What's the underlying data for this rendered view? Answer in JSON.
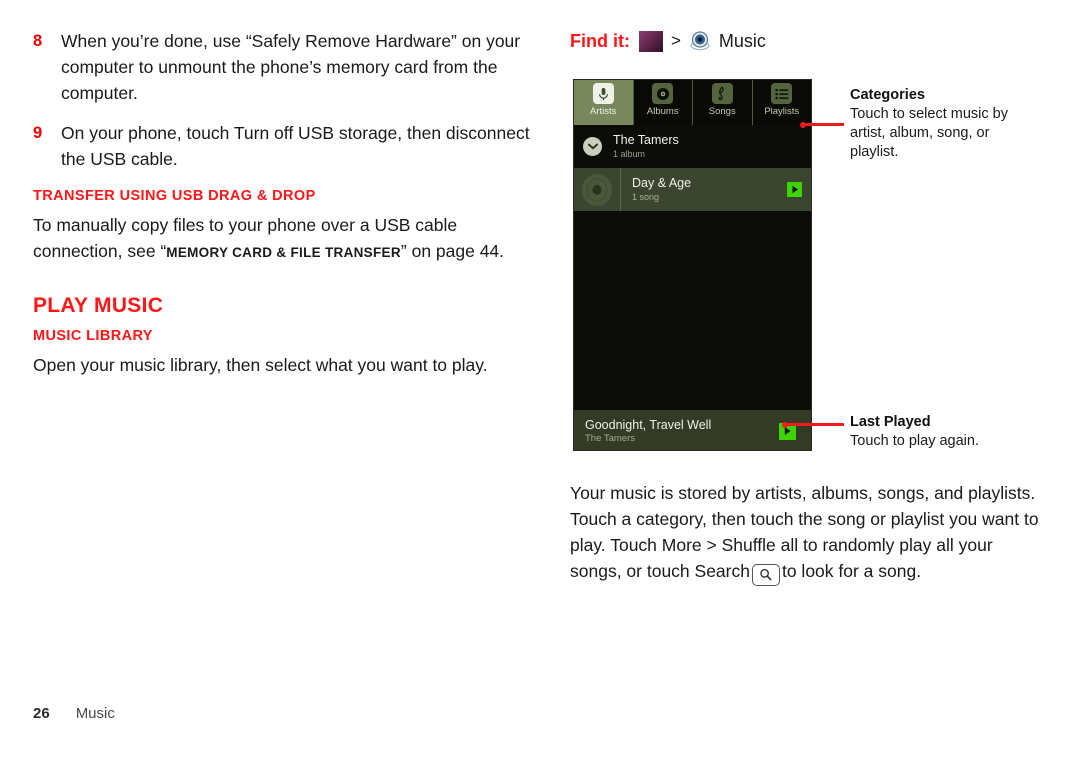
{
  "steps": [
    {
      "num": "8",
      "text": "When you’re done, use “Safely Remove Hardware” on your computer to unmount the phone’s memory card from the computer."
    },
    {
      "num": "9",
      "text": "On your phone, touch Turn off USB storage, then disconnect the USB cable."
    }
  ],
  "left": {
    "transfer_heading": "TRANSFER USING USB DRAG & DROP",
    "transfer_p1": "To manually copy files to your phone over a USB cable connection, see “",
    "transfer_ref": "MEMORY CARD & FILE TRANSFER",
    "transfer_p2": "” on page 44.",
    "play_music_heading": "PLAY MUSIC",
    "music_library_heading": "MUSIC LIBRARY",
    "music_library_text": "Open your music library, then select what you want to play."
  },
  "find_it": {
    "label": "Find it:",
    "drawer_icon": "app-drawer-icon",
    "separator": ">",
    "music_icon": "music-app-icon",
    "app_name": "Music"
  },
  "phone": {
    "tabs": [
      {
        "label": "Artists",
        "icon": "microphone-icon",
        "active": true
      },
      {
        "label": "Albums",
        "icon": "vinyl-record-icon",
        "active": false
      },
      {
        "label": "Songs",
        "icon": "treble-clef-icon",
        "active": false
      },
      {
        "label": "Playlists",
        "icon": "list-icon",
        "active": false
      }
    ],
    "artist_row": {
      "expand_icon": "chevron-down-icon",
      "title": "The Tamers",
      "subtitle": "1 album"
    },
    "album_row": {
      "art_icon": "album-art-icon",
      "title": "Day & Age",
      "subtitle": "1 song",
      "play_icon": "play-icon"
    },
    "now_playing": {
      "title": "Goodnight, Travel Well",
      "artist": "The Tamers",
      "play_icon": "play-icon"
    }
  },
  "callouts": [
    {
      "title": "Categories",
      "text": "Touch to select music by artist, album, song, or playlist."
    },
    {
      "title": "Last Played",
      "text": "Touch to play again."
    }
  ],
  "lower_paragraph": {
    "part1": "Your music is stored by artists, albums, songs, and playlists. Touch a category, then touch the song or playlist you want to play. Touch More > Shuffle all to randomly play all your songs, or touch Search",
    "search_icon": "search-icon",
    "part2": "to look for a song."
  },
  "footer": {
    "page_number": "26",
    "section": "Music"
  },
  "colors": {
    "accent_red": "#ff1616",
    "leader_red": "#ee1c1c",
    "play_green": "#3dd400",
    "tab_active": "#78885c",
    "phone_bg": "#0b0b07"
  }
}
